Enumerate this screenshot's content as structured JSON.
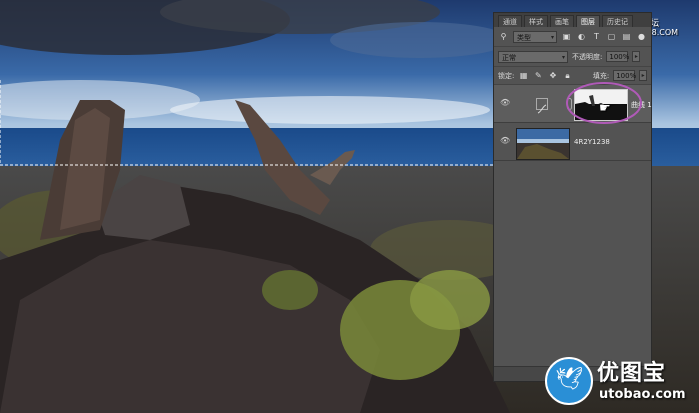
{
  "panel": {
    "tabs": [
      "通道",
      "样式",
      "画笔",
      "图层",
      "历史记"
    ],
    "active_tab_index": 3,
    "filter_kind": "类型",
    "blend_mode": "正常",
    "opacity_label": "不透明度:",
    "opacity_value": "100%",
    "lock_label": "锁定:",
    "fill_label": "填充:",
    "fill_value": "100%",
    "layers": [
      {
        "name": "曲线 1",
        "type": "curves-adjustment",
        "visible": true,
        "selected": true
      },
      {
        "name": "4R2Y1238",
        "type": "image",
        "visible": true,
        "selected": false
      }
    ]
  },
  "watermark": {
    "line1": "PS教程论坛",
    "line2": "BBS.16XX8.COM"
  },
  "logo": {
    "name": "优图宝",
    "url": "utobao.com"
  },
  "colors": {
    "panel_bg": "#535353",
    "highlight_ring": "#b05ab8",
    "logo_blue": "#2a8fd6"
  }
}
